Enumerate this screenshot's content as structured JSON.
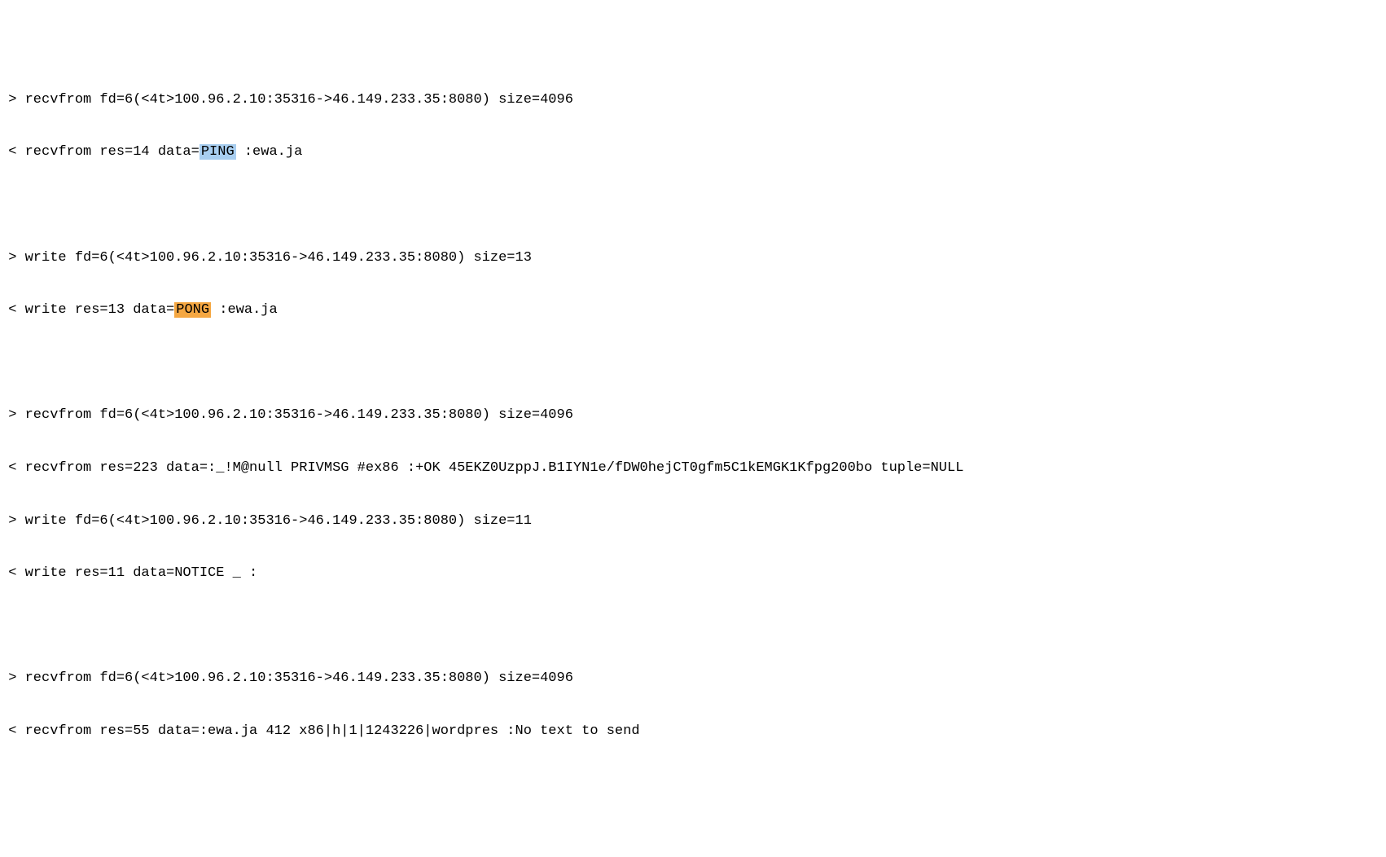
{
  "lines": {
    "l1_prefix": " > recvfrom fd=6(<4t>100.96.2.10:35316->46.149.233.35:8080) size=4096",
    "l2_prefix": " < recvfrom res=14 data=",
    "l2_hl": "PING",
    "l2_suffix": " :ewa.ja",
    "l3_prefix": " > write fd=6(<4t>100.96.2.10:35316->46.149.233.35:8080) size=13",
    "l4_prefix": " < write res=13 data=",
    "l4_hl": "PONG",
    "l4_suffix": " :ewa.ja",
    "l5": " > recvfrom fd=6(<4t>100.96.2.10:35316->46.149.233.35:8080) size=4096",
    "l6": " < recvfrom res=223 data=:_!M@null PRIVMSG #ex86 :+OK 45EKZ0UzppJ.B1IYN1e/fDW0hejCT0gfm5C1kEMGK1Kfpg200bo tuple=NULL",
    "l7": " > write fd=6(<4t>100.96.2.10:35316->46.149.233.35:8080) size=11",
    "l8": " < write res=11 data=NOTICE _ :",
    "l9": " > recvfrom fd=6(<4t>100.96.2.10:35316->46.149.233.35:8080) size=4096",
    "l10": " < recvfrom res=55 data=:ewa.ja 412 x86|h|1|1243226|wordpres :No text to send"
  },
  "highlights": {
    "ping_color": "#a8cef0",
    "pong_color": "#f5a742"
  }
}
